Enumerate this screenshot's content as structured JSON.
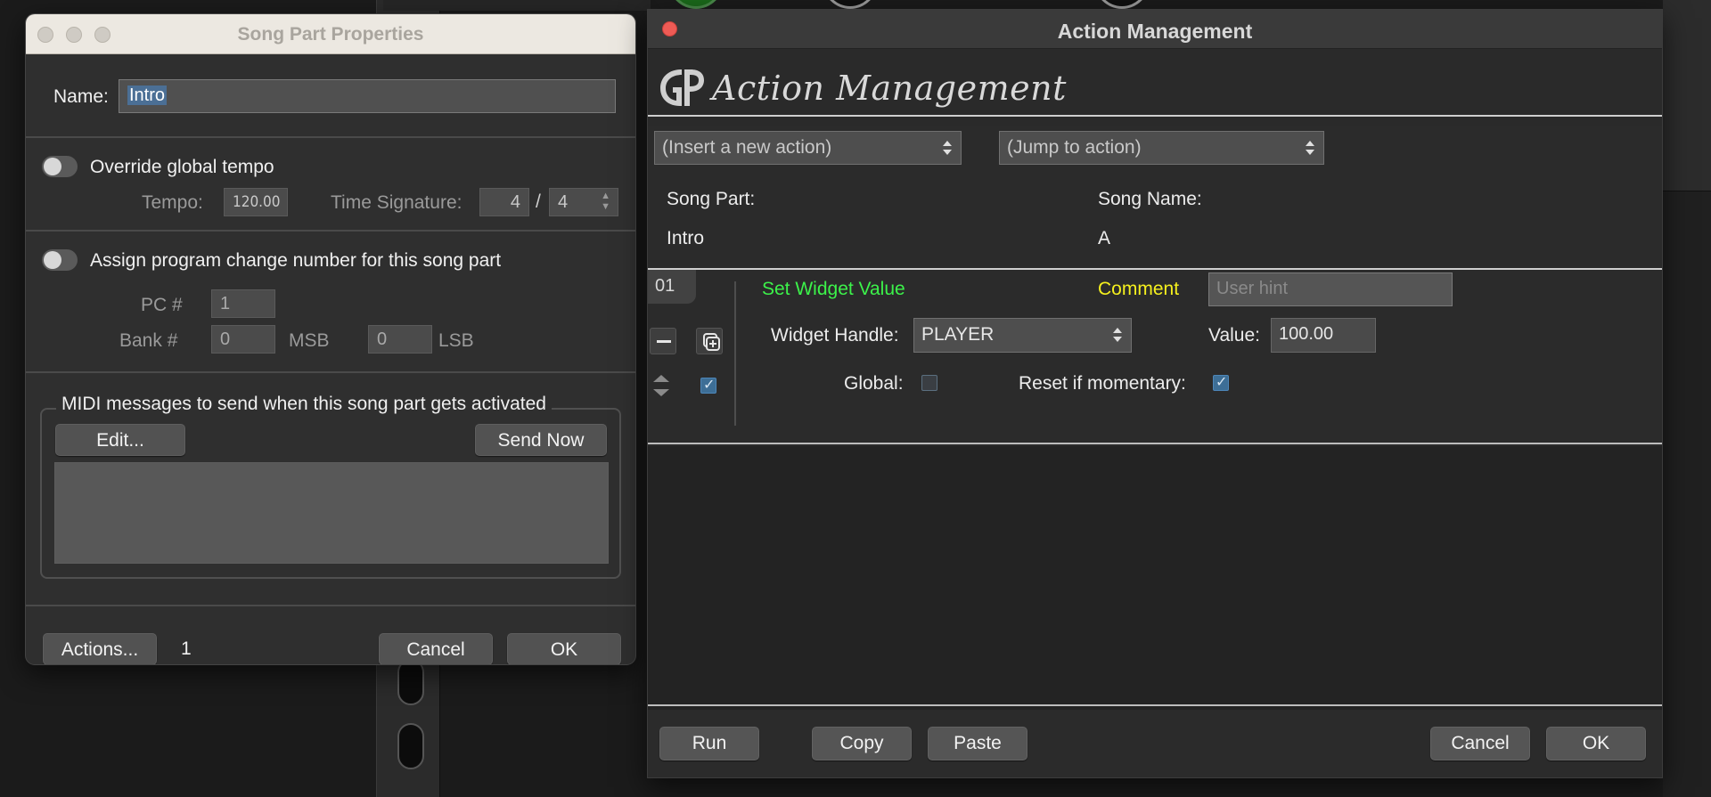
{
  "song_part_properties": {
    "title": "Song Part Properties",
    "name_label": "Name:",
    "name_value": "Intro",
    "override_tempo_label": "Override global tempo",
    "tempo_label": "Tempo:",
    "tempo_value": "120.00",
    "time_signature_label": "Time Signature:",
    "ts_numerator": "4",
    "ts_separator": "/",
    "ts_denominator": "4",
    "assign_pc_label": "Assign program change number for this song part",
    "pc_label": "PC #",
    "pc_value": "1",
    "bank_label": "Bank #",
    "msb_value": "0",
    "msb_label": "MSB",
    "lsb_value": "0",
    "lsb_label": "LSB",
    "midi_group_title": "MIDI messages to send when this song part gets activated",
    "edit_button": "Edit...",
    "send_now_button": "Send Now",
    "actions_button": "Actions...",
    "actions_count": "1",
    "cancel_button": "Cancel",
    "ok_button": "OK"
  },
  "action_management": {
    "window_title": "Action Management",
    "logo_text": "Action Management",
    "insert_action_select": "(Insert a new action)",
    "jump_action_select": "(Jump to action)",
    "song_part_label": "Song Part:",
    "song_part_value": "Intro",
    "song_name_label": "Song Name:",
    "song_name_value": "A",
    "action": {
      "number": "01",
      "type": "Set Widget Value",
      "comment_label": "Comment",
      "comment_placeholder": "User hint",
      "widget_handle_label": "Widget Handle:",
      "widget_handle_value": "PLAYER",
      "value_label": "Value:",
      "value": "100.00",
      "global_label": "Global:",
      "global_checked": false,
      "reset_label": "Reset if momentary:",
      "reset_checked": true,
      "enabled_checked": true
    },
    "run_button": "Run",
    "copy_button": "Copy",
    "paste_button": "Paste",
    "cancel_button": "Cancel",
    "ok_button": "OK"
  },
  "colors": {
    "action_type": "#3cf24a",
    "comment_label": "#f5f01e",
    "close_button": "#ee5b55",
    "checkbox_checked": "#3d6e96"
  }
}
